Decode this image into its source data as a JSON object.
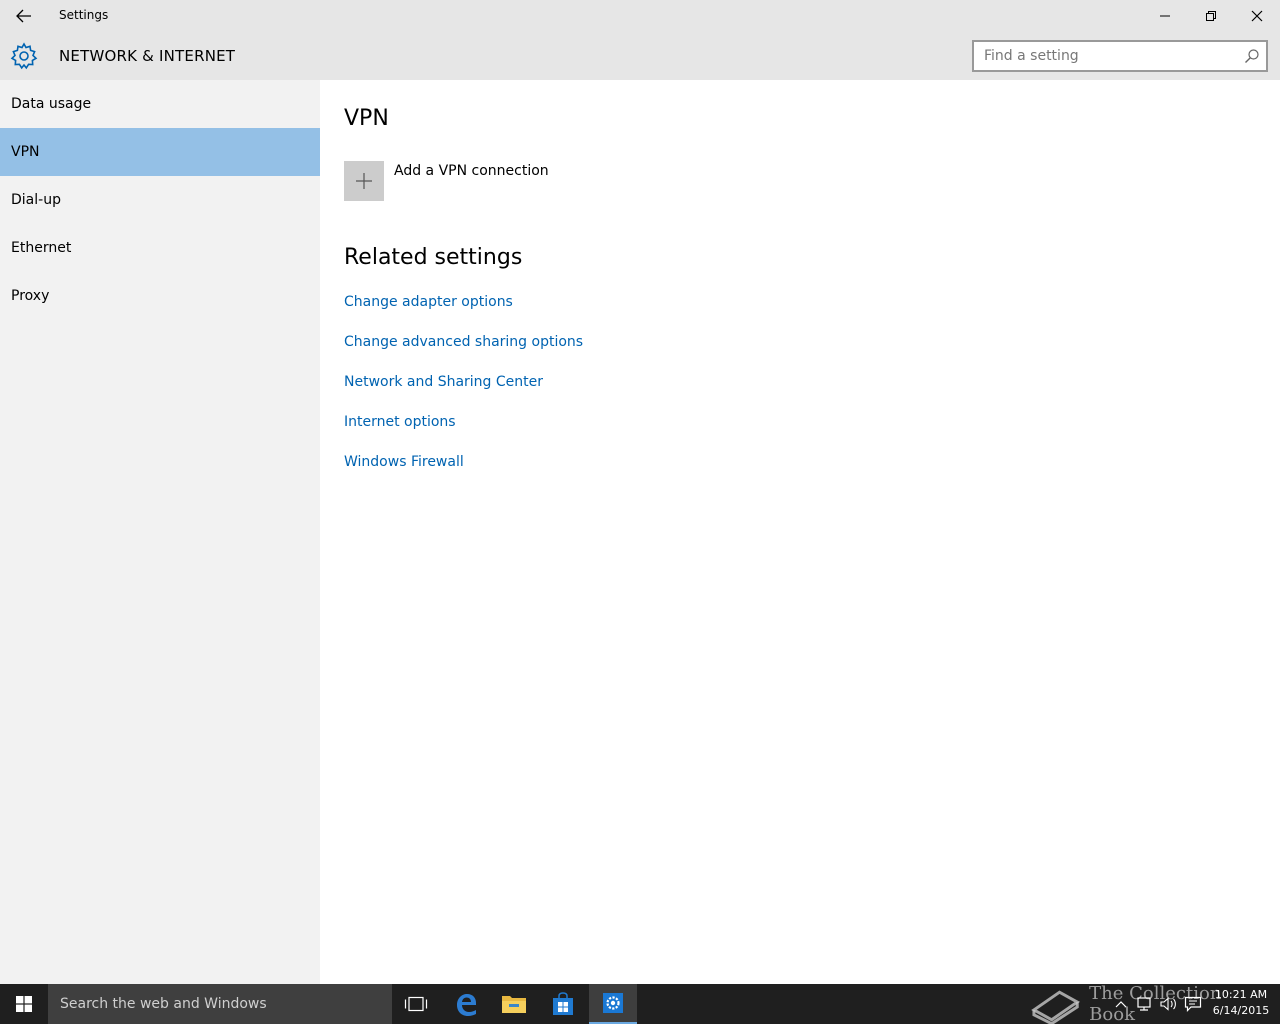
{
  "window": {
    "title": "Settings"
  },
  "header": {
    "section_title": "NETWORK & INTERNET",
    "search_placeholder": "Find a setting"
  },
  "sidebar": {
    "items": [
      {
        "label": "Data usage",
        "selected": false
      },
      {
        "label": "VPN",
        "selected": true
      },
      {
        "label": "Dial-up",
        "selected": false
      },
      {
        "label": "Ethernet",
        "selected": false
      },
      {
        "label": "Proxy",
        "selected": false
      }
    ]
  },
  "main": {
    "title": "VPN",
    "add_vpn_label": "Add a VPN connection",
    "related_title": "Related settings",
    "links": [
      "Change adapter options",
      "Change advanced sharing options",
      "Network and Sharing Center",
      "Internet options",
      "Windows Firewall"
    ]
  },
  "taskbar": {
    "search_text": "Search the web and Windows",
    "clock_time": "10:21 AM",
    "clock_date": "6/14/2015",
    "watermark": "The Collection Book"
  },
  "colors": {
    "accent": "#0063b1",
    "selected_nav": "#94c0e6",
    "chrome": "#e6e6e6",
    "sidebar": "#f2f2f2",
    "taskbar": "#1f1f1f"
  },
  "icons": {
    "back": "back-arrow-icon",
    "settings": "gear-icon",
    "search": "search-icon",
    "add": "plus-icon",
    "minimize": "minimize-icon",
    "maximize": "restore-icon",
    "close": "close-icon",
    "start": "windows-logo-icon",
    "task_view": "task-view-icon",
    "edge": "edge-icon",
    "explorer": "folder-icon",
    "store": "store-icon",
    "settings_app": "settings-gear-icon"
  }
}
